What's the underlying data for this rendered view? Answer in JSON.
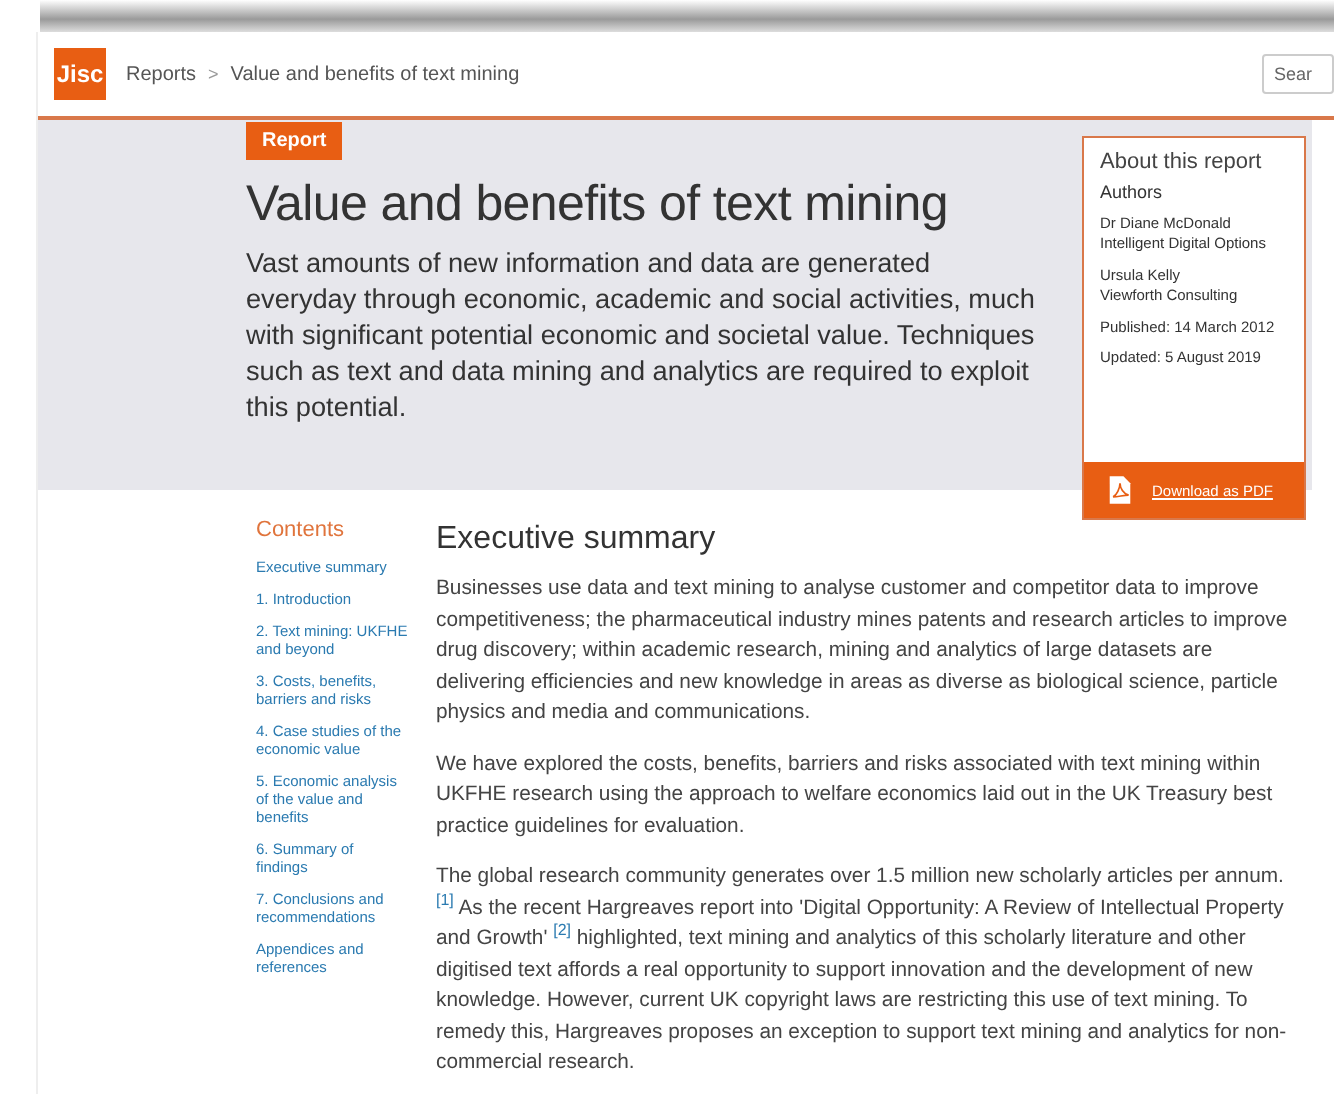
{
  "header": {
    "logo": "Jisc",
    "breadcrumb": [
      {
        "label": "Reports"
      },
      {
        "label": "Value and benefits of text mining"
      }
    ],
    "separator": ">",
    "search": {
      "placeholder": "Sear"
    }
  },
  "hero": {
    "tag": "Report",
    "title": "Value and benefits of text mining",
    "summary": "Vast amounts of new information and data are generated everyday through economic, academic and social activities, much with significant potential economic and societal value. Techniques such as text and data mining and analytics are required to exploit this potential."
  },
  "about": {
    "title": "About this report",
    "authors_heading": "Authors",
    "authors": [
      {
        "name": "Dr Diane McDonald",
        "org": "Intelligent Digital Options"
      },
      {
        "name": "Ursula Kelly",
        "org": "Viewforth Consulting"
      }
    ],
    "published": "Published: 14 March 2012",
    "updated": "Updated: 5 August 2019",
    "download": "Download as PDF"
  },
  "contents": {
    "heading": "Contents",
    "items": [
      "Executive summary",
      "1. Introduction",
      "2. Text mining: UKFHE and beyond",
      "3. Costs, benefits, barriers and risks",
      "4. Case studies of the economic value",
      "5. Economic analysis of the value and benefits",
      "6. Summary of findings",
      "7. Conclusions and recommendations",
      "Appendices and references"
    ]
  },
  "section": {
    "heading": "Executive summary",
    "paragraphs": [
      [
        {
          "kind": "text",
          "text": "Businesses use data and text mining to analyse customer and competitor data to improve competitiveness; the pharmaceutical industry mines patents and research articles to improve drug discovery; within academic research, mining and analytics of large datasets are delivering efficiencies and new knowledge in areas as diverse as biological science, particle physics and media and communications."
        }
      ],
      [
        {
          "kind": "text",
          "text": "We have explored the costs, benefits, barriers and risks associated with text mining within UKFHE research using the approach to welfare economics laid out in the UK Treasury best practice guidelines for evaluation."
        }
      ],
      [
        {
          "kind": "text",
          "text": "The global research community generates over 1.5 million new scholarly articles per annum."
        },
        {
          "kind": "ref",
          "text": "[1]"
        },
        {
          "kind": "text",
          "text": " As the recent Hargreaves report into 'Digital Opportunity: A Review of Intellectual Property and Growth' "
        },
        {
          "kind": "ref",
          "text": "[2]"
        },
        {
          "kind": "text",
          "text": " highlighted, text mining and analytics of this scholarly literature and other digitised text affords a real opportunity to support innovation and the development of new knowledge. However, current UK copyright laws are restricting this use of text mining. To remedy this, Hargreaves proposes an exception to support text mining and analytics for non-commercial research."
        }
      ]
    ]
  }
}
